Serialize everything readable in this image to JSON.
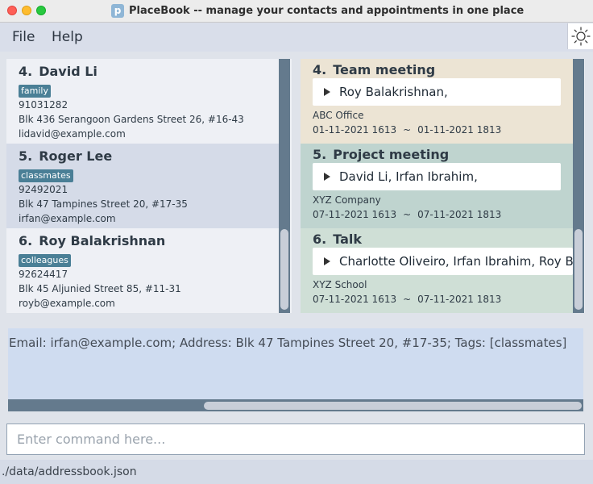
{
  "window": {
    "title": "PlaceBook -- manage your contacts and appointments in one place",
    "app_icon": "p"
  },
  "menu": {
    "file": "File",
    "help": "Help"
  },
  "theme_toggle": {
    "icon": "sun-icon",
    "glyph": "☼"
  },
  "persons": [
    {
      "index": "4.",
      "name": "David Li",
      "tag": "family",
      "phone": "91031282",
      "address": "Blk 436 Serangoon Gardens Street 26, #16-43",
      "email": "lidavid@example.com"
    },
    {
      "index": "5.",
      "name": "Roger Lee",
      "tag": "classmates",
      "phone": "92492021",
      "address": "Blk 47 Tampines Street 20, #17-35",
      "email": "irfan@example.com"
    },
    {
      "index": "6.",
      "name": "Roy Balakrishnan",
      "tag": "colleagues",
      "phone": "92624417",
      "address": "Blk 45 Aljunied Street 85, #11-31",
      "email": "royb@example.com"
    }
  ],
  "appointments": [
    {
      "index": "4.",
      "title": "Team meeting",
      "clients": "Roy Balakrishnan,",
      "location": "ABC Office",
      "start": "01-11-2021 1613",
      "separator": "~",
      "end": "01-11-2021 1813"
    },
    {
      "index": "5.",
      "title": "Project meeting",
      "clients": "David Li, Irfan Ibrahim,",
      "location": "XYZ Company",
      "start": "07-11-2021 1613",
      "separator": "~",
      "end": "07-11-2021 1813"
    },
    {
      "index": "6.",
      "title": "Talk",
      "clients": "Charlotte Oliveiro, Irfan Ibrahim, Roy Balakrishnan,",
      "location": "XYZ School",
      "start": "07-11-2021 1613",
      "separator": "~",
      "end": "07-11-2021 1813"
    }
  ],
  "result": {
    "text": "Email: irfan@example.com; Address: Blk 47 Tampines Street 20, #17-35; Tags: [classmates]"
  },
  "command": {
    "placeholder": "Enter command here...",
    "value": ""
  },
  "status": {
    "file_path": "./data/addressbook.json"
  },
  "colors": {
    "tag_bg": "#4a7f96",
    "appointment_1": "#ece4d4",
    "appointment_2": "#bfd4cf",
    "appointment_3": "#cfdfd6",
    "result_bg": "#cfdcf0",
    "scrollbar": "#647a8d"
  }
}
